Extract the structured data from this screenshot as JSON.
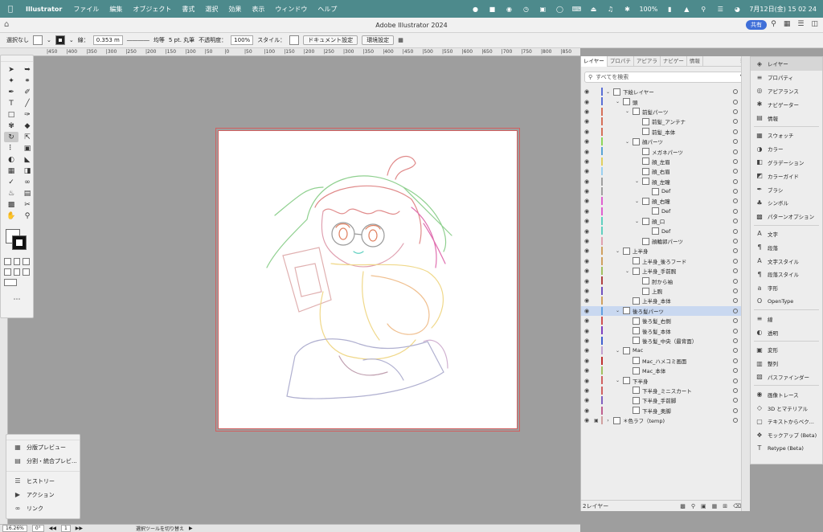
{
  "menubar": {
    "app_name": "Illustrator",
    "items": [
      "ファイル",
      "編集",
      "オブジェクト",
      "書式",
      "選択",
      "効果",
      "表示",
      "ウィンドウ",
      "ヘルプ"
    ],
    "battery": "100%",
    "datetime": "7月12日(金)  15 02 24"
  },
  "titlebar": {
    "title": "Adobe Illustrator 2024",
    "share_label": "共有"
  },
  "control_bar": {
    "selection": "選択なし",
    "stroke_label": "線：",
    "stroke_width": "0.353 m",
    "profile": "均等",
    "brush": "5 pt. 丸筆",
    "opacity_label": "不透明度：",
    "opacity_value": "100%",
    "style_label": "スタイル：",
    "document_setup": "ドキュメント設定",
    "preferences": "環境設定"
  },
  "ruler_ticks": [
    "450",
    "400",
    "350",
    "300",
    "250",
    "200",
    "150",
    "100",
    "50",
    "0",
    "50",
    "100",
    "150",
    "200",
    "250",
    "300",
    "350",
    "400",
    "450",
    "500",
    "550",
    "600",
    "650",
    "700",
    "750",
    "800",
    "850",
    "900",
    "950"
  ],
  "float_panel": {
    "items": [
      {
        "icon": "separation-preview-icon",
        "label": "分版プレビュー"
      },
      {
        "icon": "flattener-preview-icon",
        "label": "分割・統合プレビ..."
      },
      {
        "icon": "history-icon",
        "label": "ヒストリー"
      },
      {
        "icon": "actions-icon",
        "label": "アクション"
      },
      {
        "icon": "links-icon",
        "label": "リンク"
      }
    ]
  },
  "status_bar": {
    "zoom": "16.26%",
    "rotation": "0°",
    "artboard": "1",
    "tool_info": "選択ツールを切り替え"
  },
  "layers_panel": {
    "tabs": [
      "レイヤー",
      "プロパテ",
      "アピアラ",
      "ナビゲー",
      "情報"
    ],
    "search_placeholder": "すべてを検索",
    "footer": "2レイヤー",
    "rows": [
      {
        "name": "下絵レイヤー",
        "depth": 0,
        "caret": "down",
        "color": "#5a6fd6"
      },
      {
        "name": "頭",
        "depth": 1,
        "caret": "down",
        "color": "#5a6fd6"
      },
      {
        "name": "前髪パーツ",
        "depth": 2,
        "caret": "down",
        "color": "#d6705a"
      },
      {
        "name": "前髪_アンテナ",
        "depth": 3,
        "caret": "",
        "color": "#d6705a"
      },
      {
        "name": "前髪_本体",
        "depth": 3,
        "caret": "",
        "color": "#d6705a"
      },
      {
        "name": "顔パーツ",
        "depth": 2,
        "caret": "down",
        "color": "#8fd65a"
      },
      {
        "name": "メガネパーツ",
        "depth": 3,
        "caret": "",
        "color": "#5aa4d6"
      },
      {
        "name": "顔_左眉",
        "depth": 3,
        "caret": "",
        "color": "#e0d060"
      },
      {
        "name": "顔_右眉",
        "depth": 3,
        "caret": "",
        "color": "#9ad0f0"
      },
      {
        "name": "顔_左瞳",
        "depth": 3,
        "caret": "down",
        "color": "#a0a0a0"
      },
      {
        "name": "Def",
        "depth": 4,
        "caret": "",
        "color": "#a0a0a0"
      },
      {
        "name": "顔_右瞳",
        "depth": 3,
        "caret": "down",
        "color": "#e060d0"
      },
      {
        "name": "Def",
        "depth": 4,
        "caret": "",
        "color": "#e060d0"
      },
      {
        "name": "顔_口",
        "depth": 3,
        "caret": "down",
        "color": "#60d0c0"
      },
      {
        "name": "Def",
        "depth": 4,
        "caret": "",
        "color": "#60d0c0"
      },
      {
        "name": "顔輪郭パーツ",
        "depth": 3,
        "caret": "",
        "color": "#e0a0b0"
      },
      {
        "name": "上半身",
        "depth": 1,
        "caret": "down",
        "color": "#d0a060"
      },
      {
        "name": "上半身_後ろフード",
        "depth": 2,
        "caret": "",
        "color": "#d0a060"
      },
      {
        "name": "上半身_手前腕",
        "depth": 2,
        "caret": "down",
        "color": "#a0c060"
      },
      {
        "name": "肘から袖",
        "depth": 3,
        "caret": "",
        "color": "#b04040"
      },
      {
        "name": "上腕",
        "depth": 3,
        "caret": "",
        "color": "#7050c0"
      },
      {
        "name": "上半身_本体",
        "depth": 2,
        "caret": "",
        "color": "#d0a060"
      },
      {
        "name": "後ろ髪パーツ",
        "depth": 1,
        "caret": "down",
        "color": "#60a0e0",
        "selected": true
      },
      {
        "name": "後ろ髪_右側",
        "depth": 2,
        "caret": "",
        "color": "#d05050"
      },
      {
        "name": "後ろ髪_本体",
        "depth": 2,
        "caret": "",
        "color": "#8040c0"
      },
      {
        "name": "後ろ髪_中央（最背面）",
        "depth": 2,
        "caret": "",
        "color": "#4060d0"
      },
      {
        "name": "Mac",
        "depth": 1,
        "caret": "down",
        "color": "#c0a0d0"
      },
      {
        "name": "Mac_ハメコミ画面",
        "depth": 2,
        "caret": "",
        "color": "#c03030"
      },
      {
        "name": "Mac_本体",
        "depth": 2,
        "caret": "",
        "color": "#a0c060"
      },
      {
        "name": "下半身",
        "depth": 1,
        "caret": "down",
        "color": "#d06060"
      },
      {
        "name": "下半身_ミニスカート",
        "depth": 2,
        "caret": "",
        "color": "#d06060"
      },
      {
        "name": "下半身_手前脚",
        "depth": 2,
        "caret": "",
        "color": "#8060c0"
      },
      {
        "name": "下半身_奥脚",
        "depth": 2,
        "caret": "",
        "color": "#c06090"
      },
      {
        "name": "＊色ラフ（temp)",
        "depth": 0,
        "caret": "right",
        "color": "#d0a0a0",
        "locked": true
      }
    ]
  },
  "right_panel": {
    "groups": [
      [
        {
          "icon": "layers-icon",
          "label": "レイヤー",
          "active": true
        },
        {
          "icon": "properties-icon",
          "label": "プロパティ"
        },
        {
          "icon": "appearance-icon",
          "label": "アピアランス"
        },
        {
          "icon": "navigator-icon",
          "label": "ナビゲーター"
        },
        {
          "icon": "info-icon",
          "label": "情報"
        }
      ],
      [
        {
          "icon": "swatches-icon",
          "label": "スウォッチ"
        },
        {
          "icon": "color-icon",
          "label": "カラー"
        },
        {
          "icon": "gradient-icon",
          "label": "グラデーション"
        },
        {
          "icon": "color-guide-icon",
          "label": "カラーガイド"
        },
        {
          "icon": "brush-icon",
          "label": "ブラシ"
        },
        {
          "icon": "symbol-icon",
          "label": "シンボル"
        },
        {
          "icon": "pattern-options-icon",
          "label": "パターンオプション"
        }
      ],
      [
        {
          "icon": "character-icon",
          "label": "文字"
        },
        {
          "icon": "paragraph-icon",
          "label": "段落"
        },
        {
          "icon": "character-style-icon",
          "label": "文字スタイル"
        },
        {
          "icon": "paragraph-style-icon",
          "label": "段落スタイル"
        },
        {
          "icon": "glyphs-icon",
          "label": "字形"
        },
        {
          "icon": "opentype-icon",
          "label": "OpenType"
        }
      ],
      [
        {
          "icon": "stroke-icon",
          "label": "線"
        },
        {
          "icon": "transparency-icon",
          "label": "透明"
        }
      ],
      [
        {
          "icon": "transform-icon",
          "label": "変形"
        },
        {
          "icon": "align-icon",
          "label": "整列"
        },
        {
          "icon": "pathfinder-icon",
          "label": "パスファインダー"
        }
      ],
      [
        {
          "icon": "image-trace-icon",
          "label": "画像トレース"
        },
        {
          "icon": "3d-materials-icon",
          "label": "3D とマテリアル"
        },
        {
          "icon": "text-to-vector-icon",
          "label": "テキストからベク..."
        },
        {
          "icon": "mockup-icon",
          "label": "モックアップ (Beta)"
        },
        {
          "icon": "retype-icon",
          "label": "Retype (Beta)"
        }
      ]
    ]
  }
}
